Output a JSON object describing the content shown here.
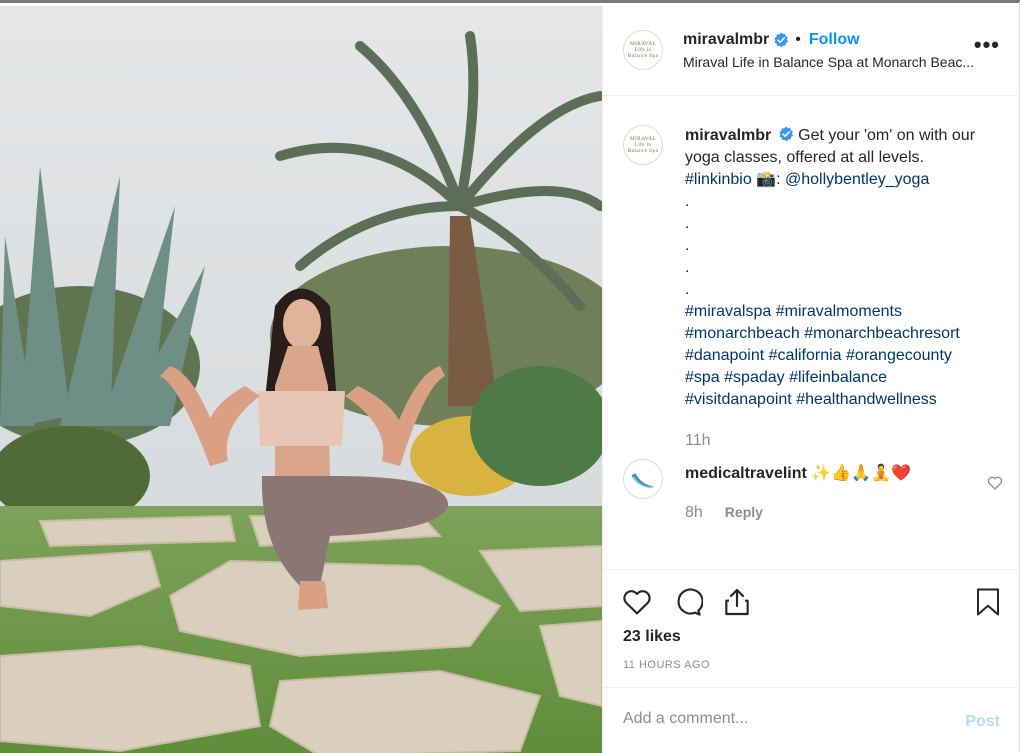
{
  "post": {
    "image_alt_icon": "yoga-photo",
    "author": {
      "username": "miravalmbr",
      "verified": true,
      "avatar_text_line1": "MIRAVAL",
      "avatar_text_line2": "Life in Balance Spa",
      "follow_label": "Follow",
      "separator": "•",
      "location": "Miraval Life in Balance Spa at Monarch Beac..."
    },
    "more_label": "•••",
    "caption": {
      "username": "miravalmbr",
      "text": "Get your 'om' on with our yoga classes, offered at all levels.",
      "linkinbio": "#linkinbio",
      "camera_emoji": "📸:",
      "mention": "@hollybentley_yoga",
      "dots": [
        ".",
        ".",
        ".",
        ".",
        "."
      ],
      "hashtag_lines": [
        [
          "#miravalspa",
          "#miravalmoments"
        ],
        [
          "#monarchbeach",
          "#monarchbeachresort"
        ],
        [
          "#danapoint",
          "#california",
          "#orangecounty"
        ],
        [
          "#spa",
          "#spaday",
          "#lifeinbalance"
        ],
        [
          "#visitdanapoint",
          "#healthandwellness"
        ]
      ],
      "time": "11h"
    },
    "comments": [
      {
        "username": "medicaltravelint",
        "text": "✨👍🙏🧘❤️",
        "time": "8h",
        "reply_label": "Reply"
      }
    ],
    "likes": "23 likes",
    "timestamp": "11 HOURS AGO",
    "add_comment_placeholder": "Add a comment...",
    "post_button": "Post",
    "colors": {
      "link_blue": "#0095f6",
      "hashtag": "#00376b",
      "muted": "#8e8e8e",
      "post_disabled": "#b2dffc",
      "verified": "#3897f0"
    }
  }
}
